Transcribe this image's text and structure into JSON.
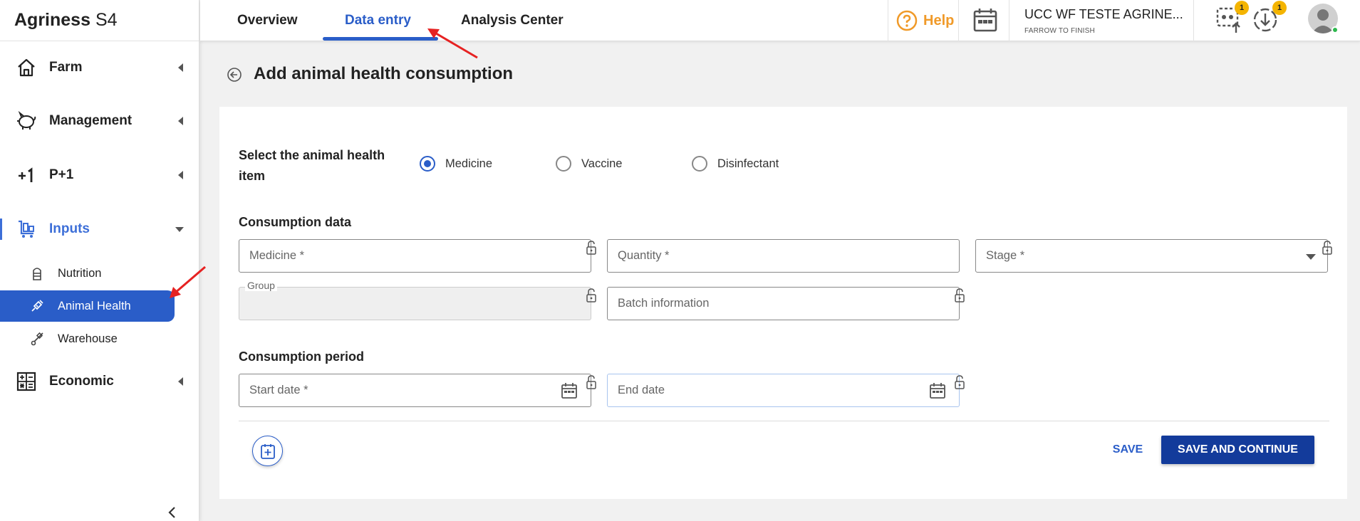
{
  "brand": {
    "name": "Agriness",
    "suffix": "S4"
  },
  "sidebar": {
    "items": [
      {
        "label": "Farm",
        "icon": "home-icon"
      },
      {
        "label": "Management",
        "icon": "pig-icon"
      },
      {
        "label": "P+1",
        "icon": "plus-one-icon"
      },
      {
        "label": "Inputs",
        "icon": "inputs-cart-icon"
      },
      {
        "label": "Economic",
        "icon": "calculator-icon"
      }
    ],
    "sub_items": [
      {
        "label": "Nutrition",
        "icon": "silo-icon"
      },
      {
        "label": "Animal Health",
        "icon": "syringe-icon"
      },
      {
        "label": "Warehouse",
        "icon": "hand-truck-icon"
      }
    ]
  },
  "tabs": [
    {
      "label": "Overview"
    },
    {
      "label": "Data entry"
    },
    {
      "label": "Analysis Center"
    }
  ],
  "header": {
    "help_label": "Help",
    "farm_name": "UCC WF TESTE AGRINE...",
    "farm_type": "FARROW TO FINISH",
    "upload_badge": "1",
    "download_badge": "1"
  },
  "page": {
    "title": "Add animal health consumption",
    "select_label_line1": "Select the animal health",
    "select_label_line2": "item",
    "radio_options": [
      "Medicine",
      "Vaccine",
      "Disinfectant"
    ],
    "selected_option": "Medicine",
    "consumption_data_label": "Consumption data",
    "medicine_placeholder": "Medicine *",
    "quantity_placeholder": "Quantity *",
    "stage_placeholder": "Stage *",
    "group_label": "Group",
    "batch_placeholder": "Batch information",
    "consumption_period_label": "Consumption period",
    "start_date_placeholder": "Start date *",
    "end_date_placeholder": "End date",
    "save_label": "SAVE",
    "save_continue_label": "SAVE AND CONTINUE"
  },
  "colors": {
    "accent": "#2a5dc8",
    "primary_button": "#133b9b",
    "help": "#f09a29",
    "badge": "#f4b400",
    "annotation": "#e62222"
  }
}
